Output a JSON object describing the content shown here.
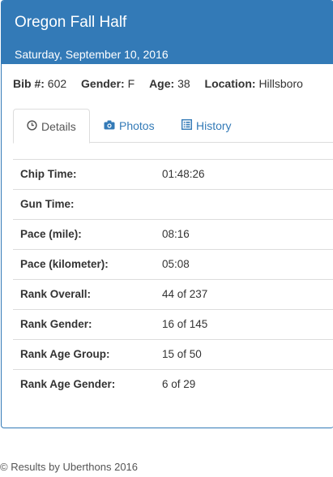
{
  "race": {
    "title": "Oregon Fall Half",
    "date": "Saturday, September 10, 2016"
  },
  "summary": {
    "bib_label": "Bib #:",
    "bib": "602",
    "gender_label": "Gender:",
    "gender": "F",
    "age_label": "Age:",
    "age": "38",
    "location_label": "Location:",
    "location": "Hillsboro"
  },
  "tabs": [
    {
      "label": "Details",
      "icon": "clock-icon",
      "active": true
    },
    {
      "label": "Photos",
      "icon": "camera-icon",
      "active": false
    },
    {
      "label": "History",
      "icon": "list-icon",
      "active": false
    }
  ],
  "results": [
    {
      "label": "Chip Time:",
      "value": "01:48:26"
    },
    {
      "label": "Gun Time:",
      "value": ""
    },
    {
      "label": "Pace (mile):",
      "value": "08:16"
    },
    {
      "label": "Pace (kilometer):",
      "value": "05:08"
    },
    {
      "label": "Rank Overall:",
      "value": "44 of 237"
    },
    {
      "label": "Rank Gender:",
      "value": "16 of 145"
    },
    {
      "label": "Rank Age Group:",
      "value": "15 of 50"
    },
    {
      "label": "Rank Age Gender:",
      "value": "6 of 29"
    }
  ],
  "footer": {
    "text": "© Results by Uberthons 2016"
  },
  "colors": {
    "primary": "#337ab7",
    "border": "#dddddd"
  }
}
